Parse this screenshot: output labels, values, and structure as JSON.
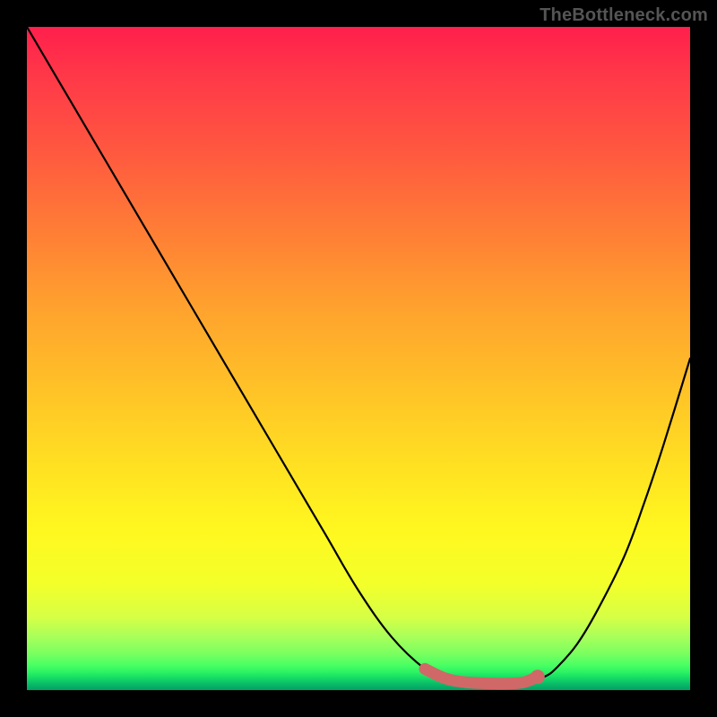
{
  "watermark": {
    "text": "TheBottleneck.com"
  },
  "chart_data": {
    "type": "line",
    "title": "",
    "xlabel": "",
    "ylabel": "",
    "xlim": [
      0,
      100
    ],
    "ylim": [
      0,
      100
    ],
    "series": [
      {
        "name": "curve",
        "x": [
          0,
          5,
          10,
          15,
          20,
          25,
          30,
          35,
          40,
          45,
          50,
          55,
          60,
          63,
          66,
          70,
          73,
          75,
          78,
          80,
          83,
          86,
          90,
          93,
          96,
          100
        ],
        "y": [
          100,
          91.5,
          83,
          74.5,
          66,
          57.5,
          49,
          40.5,
          32,
          23.5,
          15,
          8,
          3.2,
          1.8,
          1.2,
          1.0,
          1.0,
          1.2,
          2.0,
          3.5,
          7,
          12,
          20,
          28,
          37,
          50
        ]
      }
    ],
    "highlight": {
      "name": "bottleneck-range",
      "color": "#d06868",
      "points_x": [
        60,
        63,
        66,
        70,
        73,
        75,
        77
      ],
      "points_y": [
        3.2,
        1.8,
        1.2,
        1.0,
        1.0,
        1.2,
        2.0
      ]
    },
    "background_gradient": {
      "top": "#ff1f4c",
      "mid": "#ffe022",
      "bottom": "#02a166"
    }
  }
}
